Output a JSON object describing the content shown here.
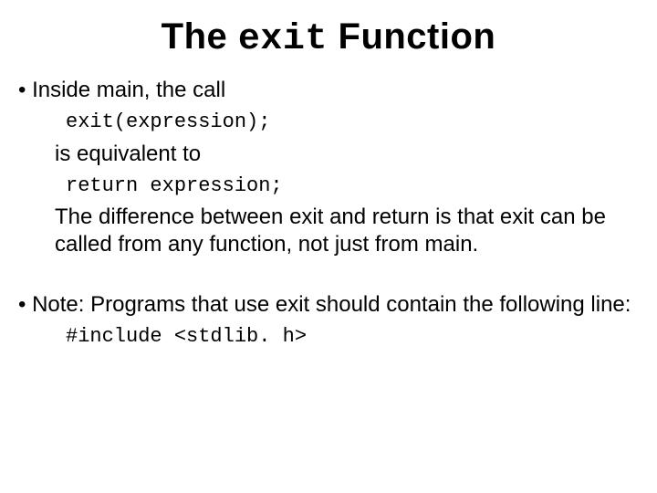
{
  "title": {
    "part1": "The ",
    "mono": "exit",
    "part2": " Function"
  },
  "bullet1": {
    "lead": "• Inside main, the call",
    "code1": "exit(expression);",
    "mid": "is equivalent to",
    "code2": "return expression;",
    "tail": "The difference between exit and return is that exit can be called from any function, not just from main."
  },
  "bullet2": {
    "lead": "• Note: Programs that use exit should contain the following line:",
    "code": "#include <stdlib. h>"
  }
}
